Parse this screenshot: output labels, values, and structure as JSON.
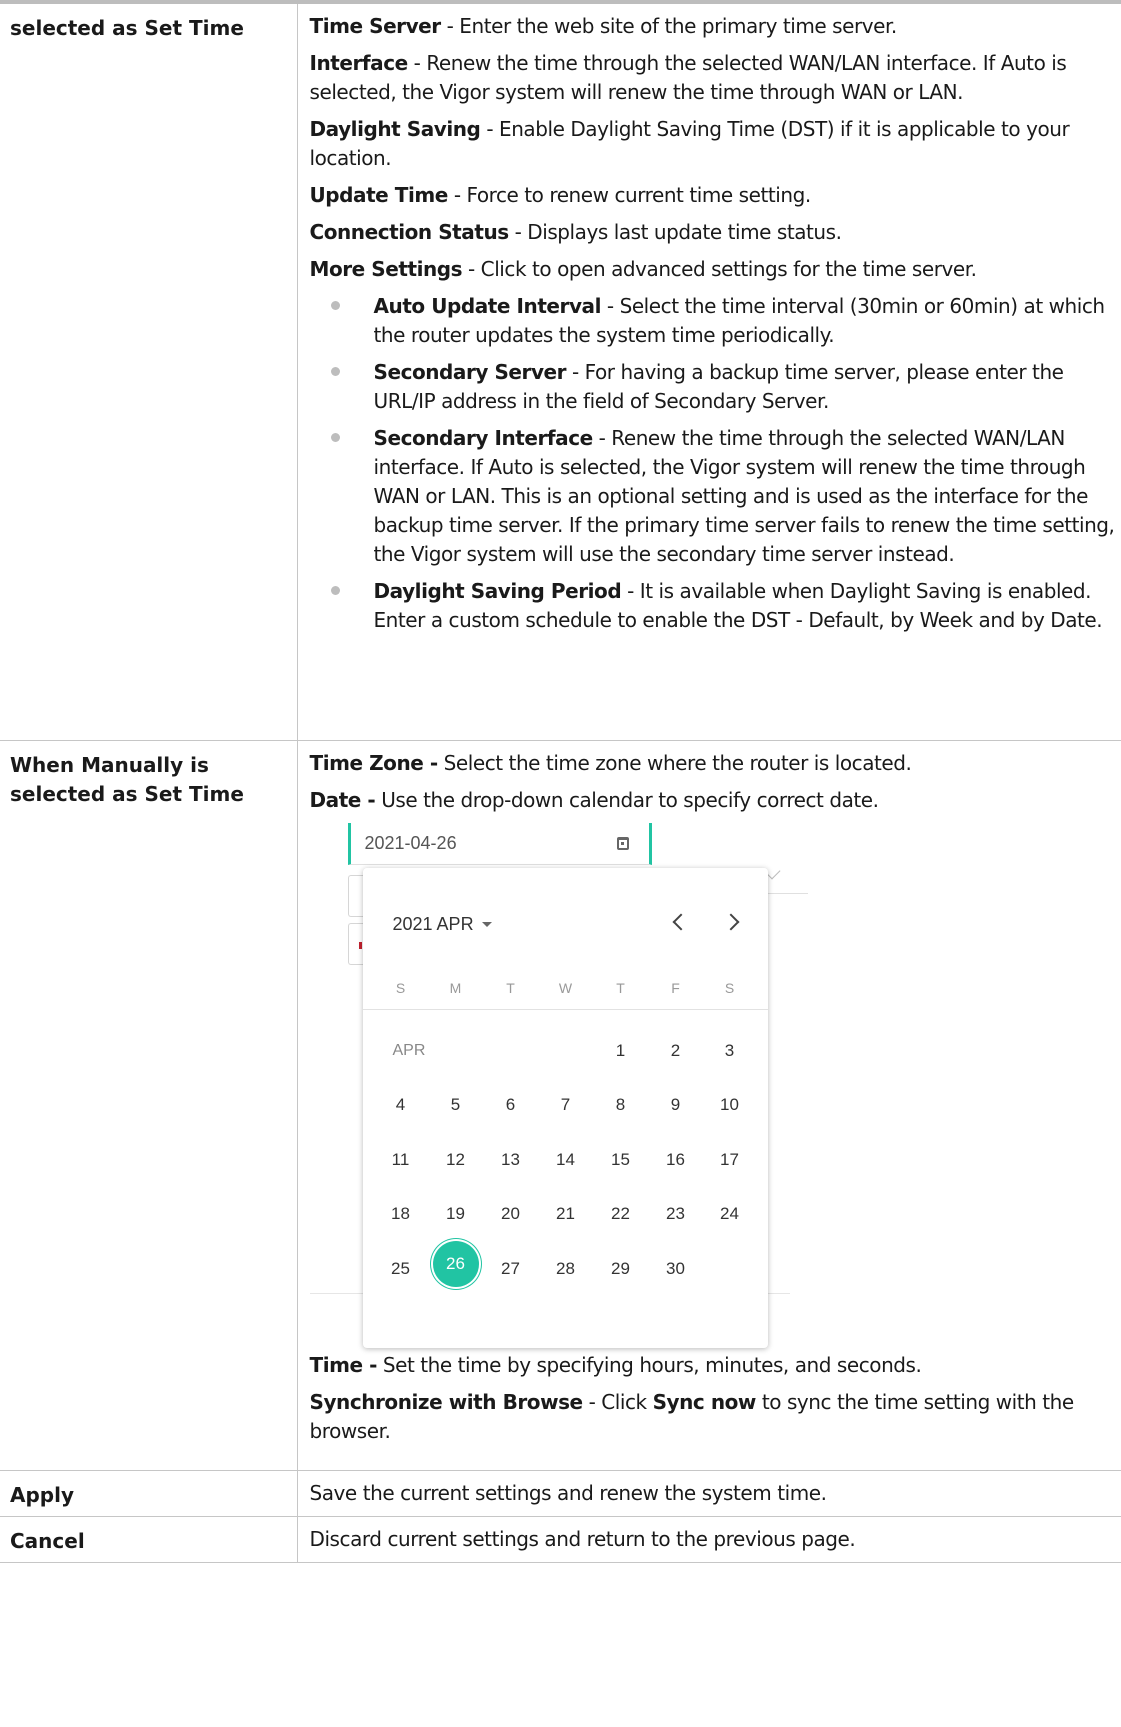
{
  "rows": [
    {
      "label": "selected as Set Time",
      "items": [
        {
          "type": "p",
          "bold": "Time Server",
          "text": " - Enter the web site of the primary time server."
        },
        {
          "type": "p",
          "bold": "Interface",
          "text": " - Renew the time through the selected WAN/LAN interface. If Auto is selected, the Vigor system will renew the time through WAN or LAN."
        },
        {
          "type": "p",
          "bold": "Daylight Saving",
          "text": " - Enable Daylight Saving Time (DST) if it is applicable to your location."
        },
        {
          "type": "p",
          "bold": "Update Time",
          "text": " - Force to renew current time setting."
        },
        {
          "type": "p",
          "bold": "Connection Status",
          "text": " - Displays last update time status."
        },
        {
          "type": "p",
          "bold": "More Settings",
          "text": " - Click to open advanced settings for the time server."
        },
        {
          "type": "bullet",
          "bold": "Auto Update Interval",
          "text": " - Select the time interval (30min or 60min) at which the router updates the system time periodically."
        },
        {
          "type": "bullet",
          "bold": "Secondary Server",
          "text": " - For having a backup time server, please enter the URL/IP address in the field of Secondary Server."
        },
        {
          "type": "bullet",
          "bold": "Secondary Interface",
          "text": " - Renew the time through the selected WAN/LAN interface. If Auto is selected, the Vigor system will renew the time through WAN or LAN. This is an optional setting and is used as the interface for the backup time server. If the primary time server fails to renew the time setting, the Vigor system will use the secondary time server instead."
        },
        {
          "type": "bullet",
          "bold": "Daylight Saving Period",
          "text": " - It is available when Daylight Saving is enabled. Enter a custom schedule to enable the DST - Default, by Week and by Date."
        }
      ]
    },
    {
      "label": "When Manually is selected as Set Time",
      "items_before": [
        {
          "type": "p",
          "bold": "Time Zone -",
          "text": " Select the time zone where the router is located."
        },
        {
          "type": "p",
          "bold": "Date -",
          "text": " Use the drop-down calendar to specify correct date."
        }
      ],
      "items_after": [
        {
          "type": "p",
          "bold": "Time -",
          "text": " Set the time by specifying hours, minutes, and seconds."
        }
      ],
      "sync": {
        "bold": "Synchronize with Browse",
        "mid": " - Click ",
        "bold2": "Sync now",
        "end": " to sync the time setting with the browser."
      }
    },
    {
      "label": "Apply",
      "desc": "Save the current settings and renew the system time."
    },
    {
      "label": "Cancel",
      "desc": "Discard current settings and return to the previous page."
    }
  ],
  "calendar": {
    "input_value": "2021-04-26",
    "header": "2021 APR",
    "weekdays": [
      "S",
      "M",
      "T",
      "W",
      "T",
      "F",
      "S"
    ],
    "month_label": "APR",
    "selected_day": "26",
    "accent_color": "#21c4a3",
    "weeks": [
      [
        "",
        "",
        "",
        "",
        "1",
        "2",
        "3"
      ],
      [
        "4",
        "5",
        "6",
        "7",
        "8",
        "9",
        "10"
      ],
      [
        "11",
        "12",
        "13",
        "14",
        "15",
        "16",
        "17"
      ],
      [
        "18",
        "19",
        "20",
        "21",
        "22",
        "23",
        "24"
      ],
      [
        "25",
        "26",
        "27",
        "28",
        "29",
        "30",
        ""
      ]
    ],
    "icons": [
      "calendar-icon",
      "caret-down-icon",
      "chevron-left-icon",
      "chevron-right-icon"
    ]
  }
}
